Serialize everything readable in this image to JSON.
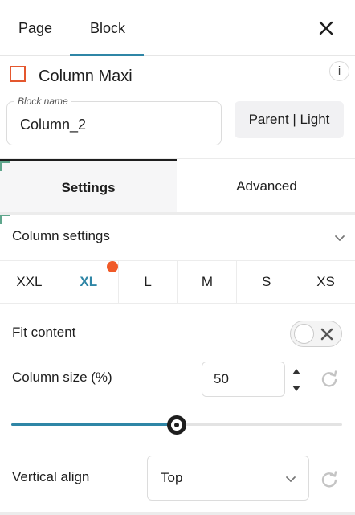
{
  "top_tabs": {
    "page": "Page",
    "block": "Block",
    "active": "Block"
  },
  "header": {
    "title": "Column Maxi",
    "info": "i"
  },
  "block_name": {
    "label": "Block name",
    "value": "Column_2"
  },
  "parent_button": "Parent | Light",
  "section_tabs": {
    "settings": "Settings",
    "advanced": "Advanced",
    "active": "Settings"
  },
  "column_settings": {
    "title": "Column settings",
    "breakpoints": [
      "XXL",
      "XL",
      "L",
      "M",
      "S",
      "XS"
    ],
    "active_breakpoint": "XL",
    "fit_content": {
      "label": "Fit content",
      "enabled": false
    },
    "column_size": {
      "label": "Column size (%)",
      "value": "50",
      "slider_fraction": 0.5
    },
    "vertical_align": {
      "label": "Vertical align",
      "value": "Top"
    }
  },
  "colors": {
    "accent": "#2f86a6",
    "indicator": "#f05a28",
    "block_icon": "#e4572e"
  }
}
